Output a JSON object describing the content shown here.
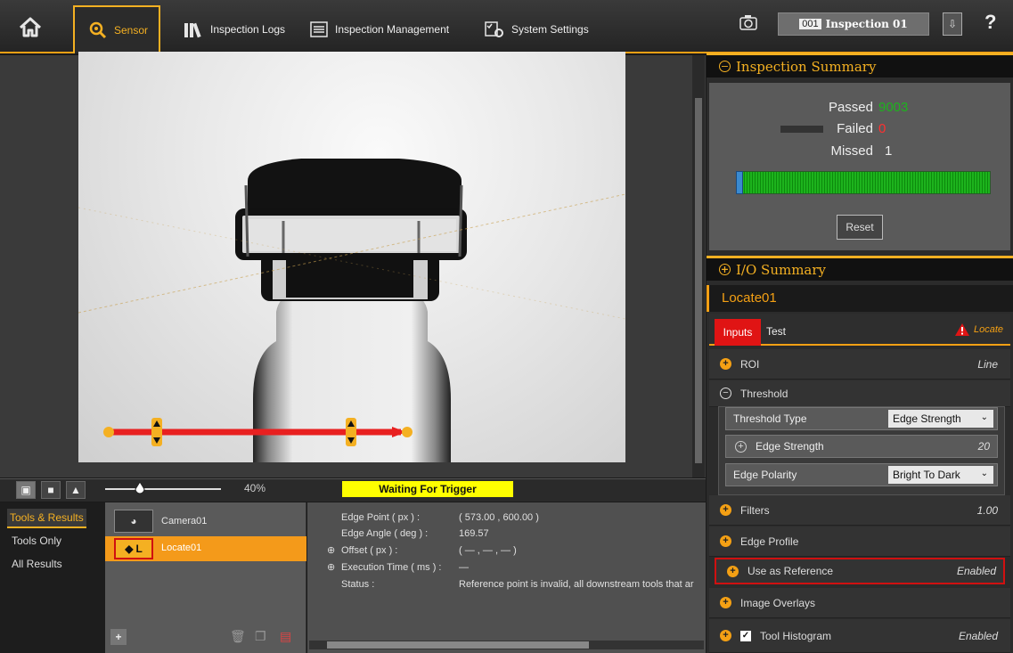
{
  "nav": {
    "sensor_label": "Sensor",
    "inspection_logs_label": "Inspection Logs",
    "inspection_management_label": "Inspection Management",
    "system_settings_label": "System Settings",
    "inspection_number": "001",
    "inspection_name": "Inspection 01",
    "help_label": "?"
  },
  "viewer": {
    "zoom_value": "40%",
    "status_text": "Waiting For Trigger"
  },
  "left_nav": {
    "items": [
      "Tools & Results",
      "Tools Only",
      "All Results"
    ],
    "active_index": 0
  },
  "tools": {
    "items": [
      {
        "label": "Camera01"
      },
      {
        "label": "Locate01",
        "tag": "L"
      }
    ],
    "selected_index": 1,
    "add_label": "+"
  },
  "results": {
    "rows": [
      {
        "label": "Edge Point ( px ) :",
        "value": "( 573.00 , 600.00 )"
      },
      {
        "label": "Edge Angle ( deg ) :",
        "value": "169.57"
      },
      {
        "label": "Offset ( px ) :",
        "value": "( — , — , — )"
      },
      {
        "label": "Execution Time ( ms ) :",
        "value": "—"
      },
      {
        "label": "Status :",
        "value": "Reference point is invalid, all downstream tools that ar"
      }
    ]
  },
  "summary": {
    "title": "Inspection Summary",
    "passed_label": "Passed",
    "passed_value": "9003",
    "failed_label": "Failed",
    "failed_value": "0",
    "missed_label": "Missed",
    "missed_value": "1",
    "reset_label": "Reset",
    "passed_fraction": 0.99
  },
  "io_summary": {
    "title": "I/O Summary"
  },
  "tool_panel": {
    "title": "Locate01",
    "tab_inputs": "Inputs",
    "tab_test": "Test",
    "warning_label": "Locate",
    "roi_label": "ROI",
    "roi_value": "Line",
    "threshold_label": "Threshold",
    "threshold_type_label": "Threshold Type",
    "threshold_type_value": "Edge Strength",
    "edge_strength_label": "Edge Strength",
    "edge_strength_value": "20",
    "edge_polarity_label": "Edge Polarity",
    "edge_polarity_value": "Bright To Dark",
    "filters_label": "Filters",
    "filters_value": "1.00",
    "edge_profile_label": "Edge Profile",
    "use_as_reference_label": "Use as Reference",
    "use_as_reference_value": "Enabled",
    "image_overlays_label": "Image Overlays",
    "tool_histogram_label": "Tool Histogram",
    "tool_histogram_value": "Enabled"
  },
  "colors": {
    "accent": "#f4a014",
    "passed": "#1db31d",
    "failed": "#ff3030",
    "status_bg": "#ffff00"
  }
}
